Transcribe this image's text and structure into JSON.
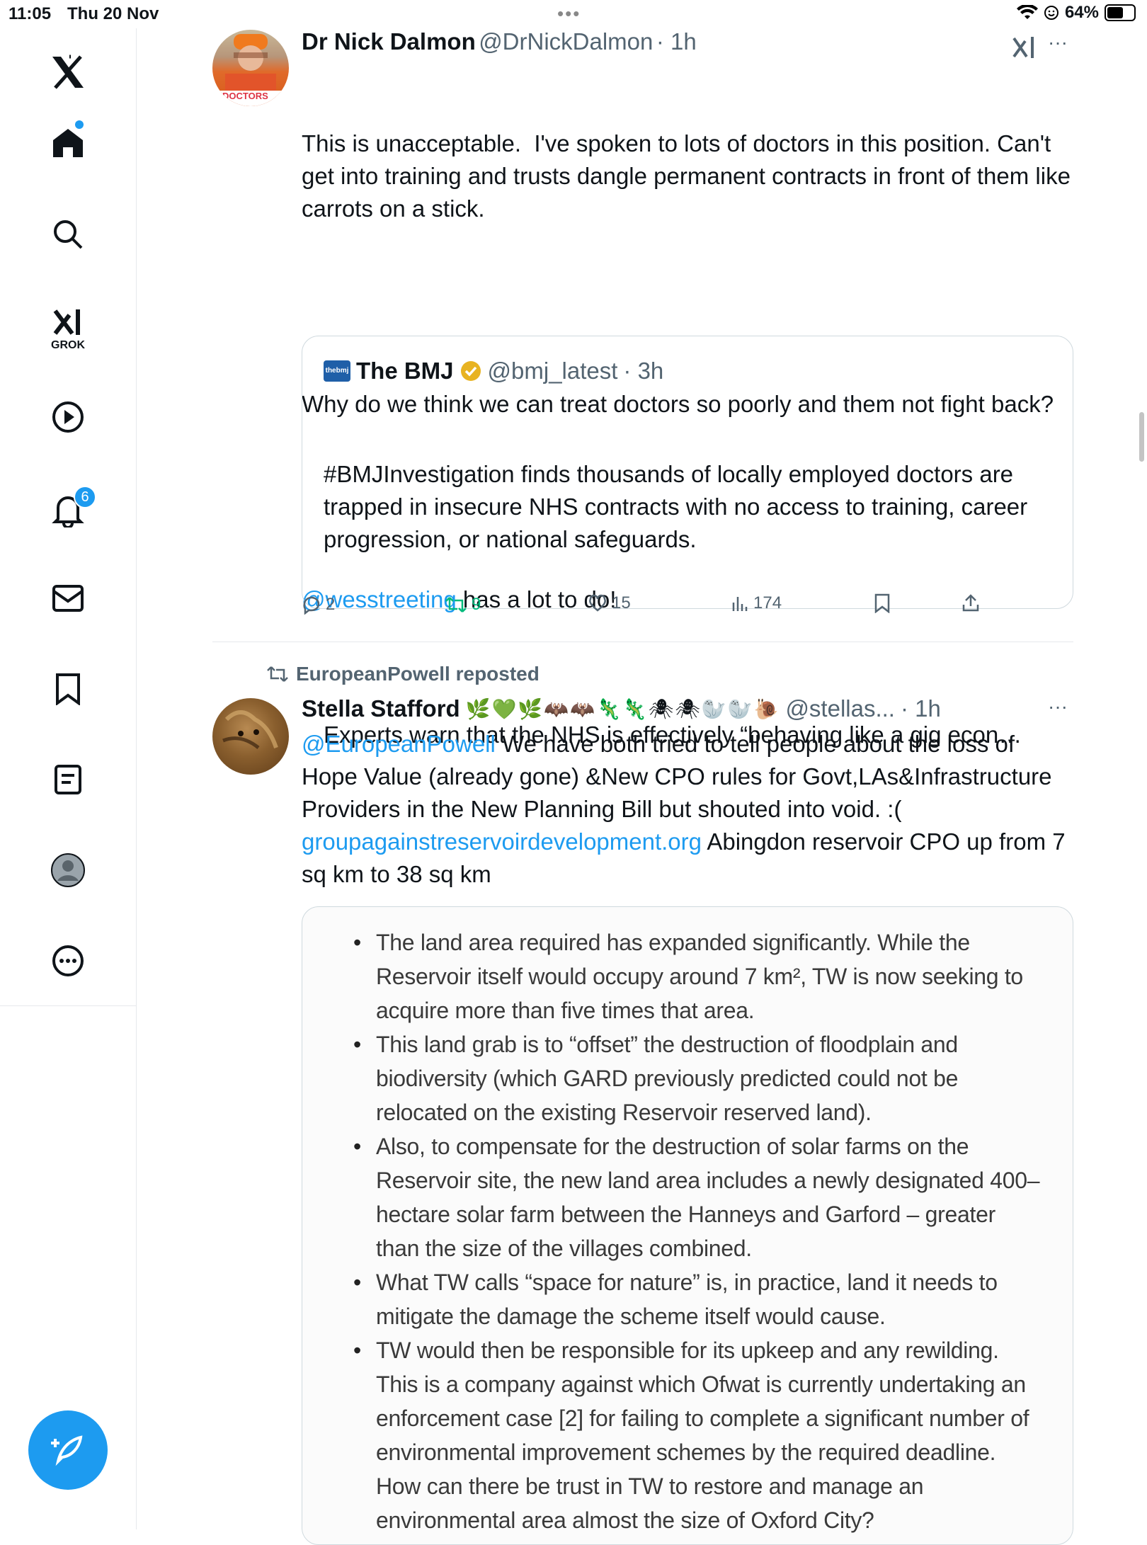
{
  "status_bar": {
    "time": "11:05",
    "date": "Thu 20 Nov",
    "battery": "64%",
    "battery_level": 0.64
  },
  "sidebar": {
    "items": [
      {
        "name": "x-logo",
        "icon": "x-logo"
      },
      {
        "name": "home",
        "icon": "home-icon",
        "has_dot": true
      },
      {
        "name": "search",
        "icon": "search-icon"
      },
      {
        "name": "grok",
        "icon": "grok-icon",
        "label": "GROK"
      },
      {
        "name": "videos",
        "icon": "play-icon"
      },
      {
        "name": "notifications",
        "icon": "bell-icon",
        "badge": "6"
      },
      {
        "name": "messages",
        "icon": "mail-icon"
      },
      {
        "name": "bookmarks",
        "icon": "bookmark-icon"
      },
      {
        "name": "lists",
        "icon": "list-icon"
      },
      {
        "name": "profile",
        "icon": "profile-icon"
      },
      {
        "name": "more",
        "icon": "more-icon"
      }
    ],
    "compose_icon": "compose-icon"
  },
  "tweet1": {
    "name": "Dr Nick Dalmon",
    "handle": "@DrNickDalmon",
    "time": "· 1h",
    "text1": "This is unacceptable.  I've spoken to lots of doctors in this position. Can't get into training and trusts dangle permanent contracts in front of them like carrots on a stick.",
    "text2": "Why do we think we can treat doctors so poorly and them not fight back?",
    "mention": "@wesstreeting",
    "text3": " has a lot to do!",
    "avatar_text": "DOCTORS",
    "quote": {
      "logo_text": "thebmj",
      "name": "The BMJ",
      "handle": "@bmj_latest",
      "time": "· 3h",
      "text1": "#BMJInvestigation finds thousands of locally employed doctors are trapped in insecure NHS contracts with no access to training, career progression, or national safeguards.",
      "text2": "Experts warn that the NHS is effectively “behaving like a gig econ…"
    },
    "actions": {
      "replies": "2",
      "reposts": "9",
      "likes": "15",
      "views": "174"
    }
  },
  "tweet2": {
    "repost_label": "EuropeanPowell reposted",
    "name": "Stella Stafford",
    "emojis": "🌿💚🌿🦇🦇🦎🦎🕷🕷🦭🦭🐌",
    "handle": "@stellas...",
    "time": "· 1h",
    "mention": "@EuropeanPowell",
    "text1": " We have both tried to tell people about the loss of Hope Value (already gone) &New CPO rules for Govt,LAs&Infrastructure Providers in the New Planning Bill but shouted into void. :( ",
    "link": "groupagainstreservoirdevelopment.org",
    "text2": " Abingdon reservoir CPO up from 7 sq km to 38 sq km",
    "image_bullets": [
      "The land area required has expanded significantly. While the Reservoir itself would occupy around 7 km², TW is now seeking to acquire more than five times that area.",
      "This land grab is to “offset” the destruction of floodplain and biodiversity (which GARD previously predicted could not be relocated on the existing Reservoir reserved land).",
      "Also, to compensate for the destruction of solar farms on the Reservoir site, the new land area includes a newly designated 400–hectare solar farm between the Hanneys and Garford – greater than the size of the villages combined.",
      "What TW calls “space for nature” is, in practice, land it needs to mitigate the damage the scheme itself would cause.",
      "TW would then be responsible for its upkeep and any rewilding. This is a company against which  Ofwat is currently undertaking an enforcement case [2] for failing to complete a significant number of environmental improvement schemes by the required deadline. How can there be trust in TW to restore and manage an environmental area almost the size of Oxford City?"
    ]
  },
  "colors": {
    "accent": "#1d9bf0",
    "repost_green": "#00ba7c",
    "muted": "#536471",
    "border": "#cfd9de"
  }
}
